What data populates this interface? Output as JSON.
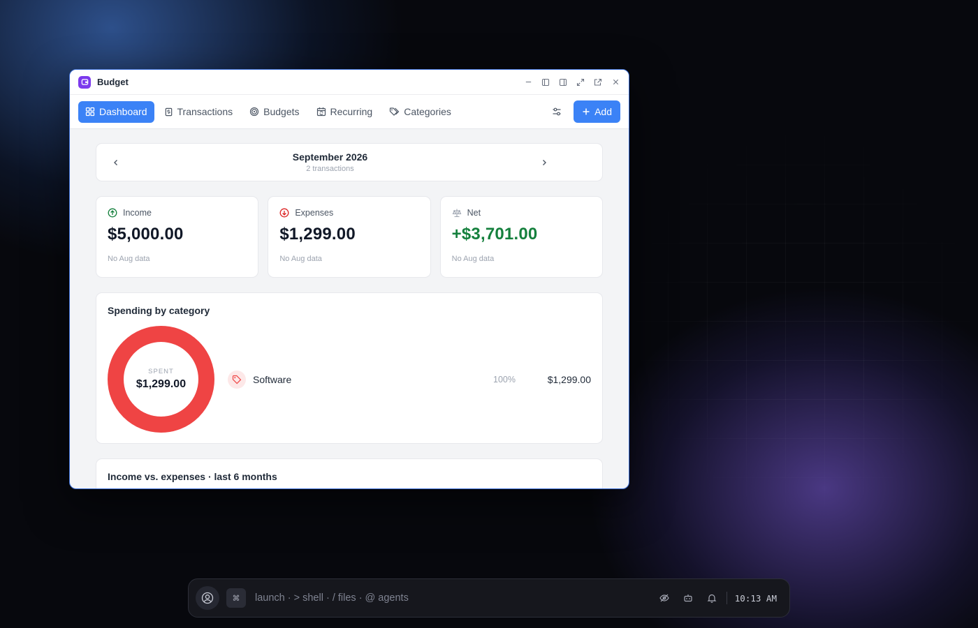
{
  "window": {
    "title": "Budget",
    "accent": "#3b82f6",
    "app_icon": "budget-app-icon",
    "controls": [
      "minimize-icon",
      "sidebar-left-icon",
      "sidebar-right-icon",
      "maximize-icon",
      "popout-icon",
      "close-icon"
    ]
  },
  "nav": {
    "tabs": [
      {
        "label": "Dashboard",
        "icon": "grid-icon",
        "active": true
      },
      {
        "label": "Transactions",
        "icon": "receipt-icon",
        "active": false
      },
      {
        "label": "Budgets",
        "icon": "target-icon",
        "active": false
      },
      {
        "label": "Recurring",
        "icon": "calendar-repeat-icon",
        "active": false
      },
      {
        "label": "Categories",
        "icon": "tags-icon",
        "active": false
      }
    ],
    "filter_icon": "sliders-icon",
    "add_label": "Add"
  },
  "month": {
    "title": "September 2026",
    "subtitle": "2 transactions"
  },
  "stats": {
    "income": {
      "label": "Income",
      "value": "$5,000.00",
      "sub": "No Aug data",
      "color": "#15803d"
    },
    "expenses": {
      "label": "Expenses",
      "value": "$1,299.00",
      "sub": "No Aug data",
      "color": "#dc2626"
    },
    "net": {
      "label": "Net",
      "value": "+$3,701.00",
      "sub": "No Aug data",
      "color": "#15803d"
    }
  },
  "spending": {
    "title": "Spending by category",
    "center_label": "SPENT",
    "center_value": "$1,299.00",
    "donut_color": "#ef4444",
    "categories": [
      {
        "name": "Software",
        "percent": "100%",
        "amount": "$1,299.00",
        "share": 1.0,
        "icon": "tag-icon"
      }
    ]
  },
  "income_vs_expenses": {
    "title": "Income vs. expenses · last 6 months"
  },
  "taskbar": {
    "launch_text": "launch · > shell · / files · @ agents",
    "cmd_key": "⌘",
    "clock": "10:13 AM",
    "icons": [
      "eye-off-icon",
      "robot-icon",
      "bell-icon"
    ]
  }
}
